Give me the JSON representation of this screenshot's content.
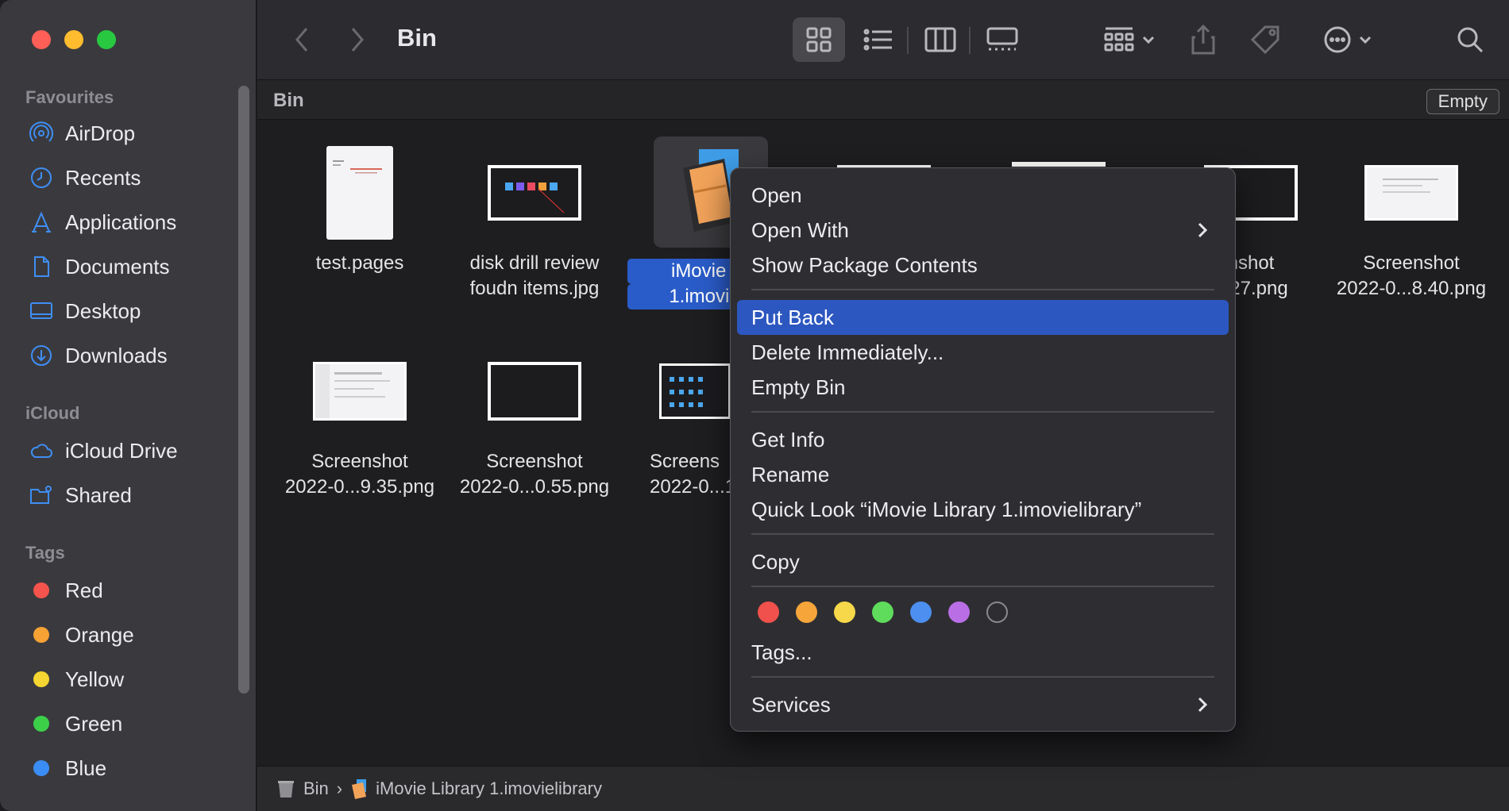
{
  "window": {
    "title": "Bin"
  },
  "sidebar": {
    "favourites_label": "Favourites",
    "favourites": [
      {
        "label": "AirDrop",
        "icon": "airdrop-icon"
      },
      {
        "label": "Recents",
        "icon": "clock-icon"
      },
      {
        "label": "Applications",
        "icon": "applications-icon"
      },
      {
        "label": "Documents",
        "icon": "document-icon"
      },
      {
        "label": "Desktop",
        "icon": "desktop-icon"
      },
      {
        "label": "Downloads",
        "icon": "download-icon"
      }
    ],
    "icloud_label": "iCloud",
    "icloud": [
      {
        "label": "iCloud Drive",
        "icon": "cloud-icon"
      },
      {
        "label": "Shared",
        "icon": "shared-folder-icon"
      }
    ],
    "tags_label": "Tags",
    "tags": [
      {
        "label": "Red",
        "color": "#f4544c"
      },
      {
        "label": "Orange",
        "color": "#f6a234"
      },
      {
        "label": "Yellow",
        "color": "#f5d531"
      },
      {
        "label": "Green",
        "color": "#3cd049"
      },
      {
        "label": "Blue",
        "color": "#3b8df6"
      }
    ]
  },
  "pathbar": {
    "location": "Bin",
    "empty_button": "Empty"
  },
  "files": [
    {
      "line1": "test.pages",
      "line2": ""
    },
    {
      "line1": "disk drill review",
      "line2": "foudn items.jpg"
    },
    {
      "line1": "iMovie Lil",
      "line2": "1.imovielil"
    },
    {
      "line1": "nshot",
      "line2": "8.27.png"
    },
    {
      "line1": "Screenshot",
      "line2": "2022-0...8.40.png"
    },
    {
      "line1": "Screenshot",
      "line2": "2022-0...9.35.png"
    },
    {
      "line1": "Screenshot",
      "line2": "2022-0...0.55.png"
    },
    {
      "line1": "Screens",
      "line2": "2022-0...1.:"
    }
  ],
  "context_menu": {
    "open": "Open",
    "open_with": "Open With",
    "show_package": "Show Package Contents",
    "put_back": "Put Back",
    "delete_immediately": "Delete Immediately...",
    "empty_bin": "Empty Bin",
    "get_info": "Get Info",
    "rename": "Rename",
    "quick_look": "Quick Look “iMovie Library 1.imovielibrary”",
    "copy": "Copy",
    "tag_colors": [
      "#f0514c",
      "#f5a53a",
      "#f7d84a",
      "#5fdc5c",
      "#4c8ff0",
      "#b96ee6"
    ],
    "tags": "Tags...",
    "services": "Services"
  },
  "statusbar": {
    "crumb1": "Bin",
    "separator": "›",
    "crumb2": "iMovie Library 1.imovielibrary"
  }
}
